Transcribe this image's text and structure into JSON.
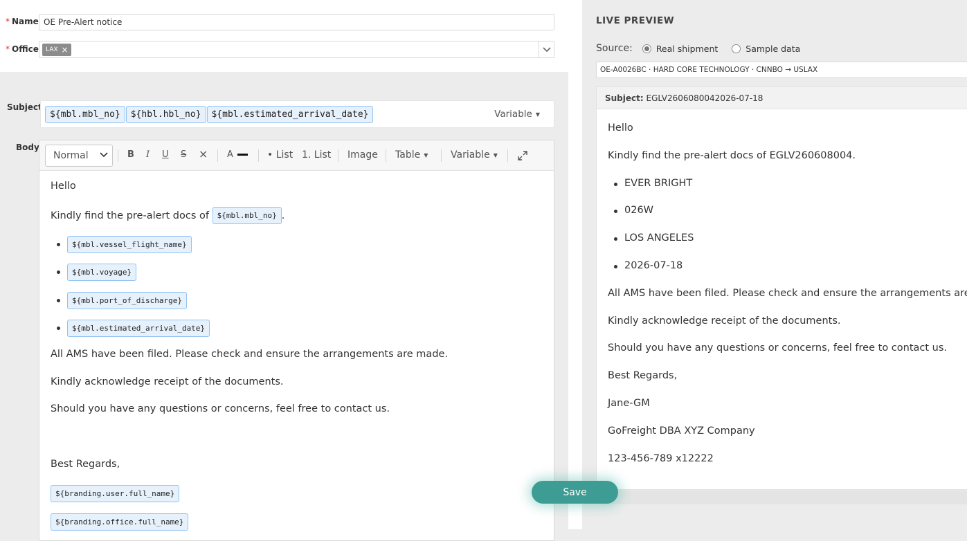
{
  "form": {
    "name_label": "Name",
    "name_value": "OE Pre-Alert notice",
    "office_label": "Office",
    "office_tag": "LAX",
    "office_tag_remove": "×",
    "subject_label": "Subject",
    "subject_chips": [
      "${mbl.mbl_no}",
      "${hbl.hbl_no}",
      "${mbl.estimated_arrival_date}"
    ],
    "subject_variable_label": "Variable",
    "body_label": "Body",
    "required_mark": "*"
  },
  "toolbar": {
    "format": "Normal",
    "bold": "B",
    "italic": "I",
    "underline": "U",
    "strike": "S",
    "clear": "×",
    "color": "A",
    "bullet_list": "• List",
    "ordered_list": "1. List",
    "image": "Image",
    "table": "Table",
    "variable": "Variable"
  },
  "body": {
    "greeting": "Hello",
    "line1_text": "Kindly find the pre-alert docs of",
    "line1_chip": "${mbl.mbl_no}",
    "line1_suffix": ".",
    "bullets": [
      "${mbl.vessel_flight_name}",
      "${mbl.voyage}",
      "${mbl.port_of_discharge}",
      "${mbl.estimated_arrival_date}"
    ],
    "ams": "All AMS have been filed. Please check and ensure the arrangements are made.",
    "ack": "Kindly acknowledge receipt of the documents.",
    "questions": "Should you have any questions or concerns, feel free to contact us.",
    "regards": "Best Regards,",
    "signature_chips": [
      "${branding.user.full_name}",
      "${branding.office.full_name}"
    ]
  },
  "save_label": "Save",
  "preview": {
    "title": "LIVE PREVIEW",
    "source_label": "Source:",
    "source_options": [
      "Real shipment",
      "Sample data"
    ],
    "selected_source": "Real shipment",
    "shipment": "OE-A0026BC · HARD CORE TECHNOLOGY · CNNBO → USLAX",
    "subject_label": "Subject:",
    "subject_value": "EGLV2606080042026-07-18",
    "greeting": "Hello",
    "line1": "Kindly find the pre-alert docs of EGLV260608004.",
    "bullets": [
      "EVER BRIGHT",
      "026W",
      "LOS ANGELES",
      "2026-07-18"
    ],
    "ams": "All AMS have been filed. Please check and ensure the arrangements are made.",
    "ack": "Kindly acknowledge receipt of the documents.",
    "questions": "Should you have any questions or concerns, feel free to contact us.",
    "regards": "Best Regards,",
    "user": "Jane-GM",
    "company": "GoFreight DBA XYZ Company",
    "phone": "123-456-789 x12222"
  }
}
